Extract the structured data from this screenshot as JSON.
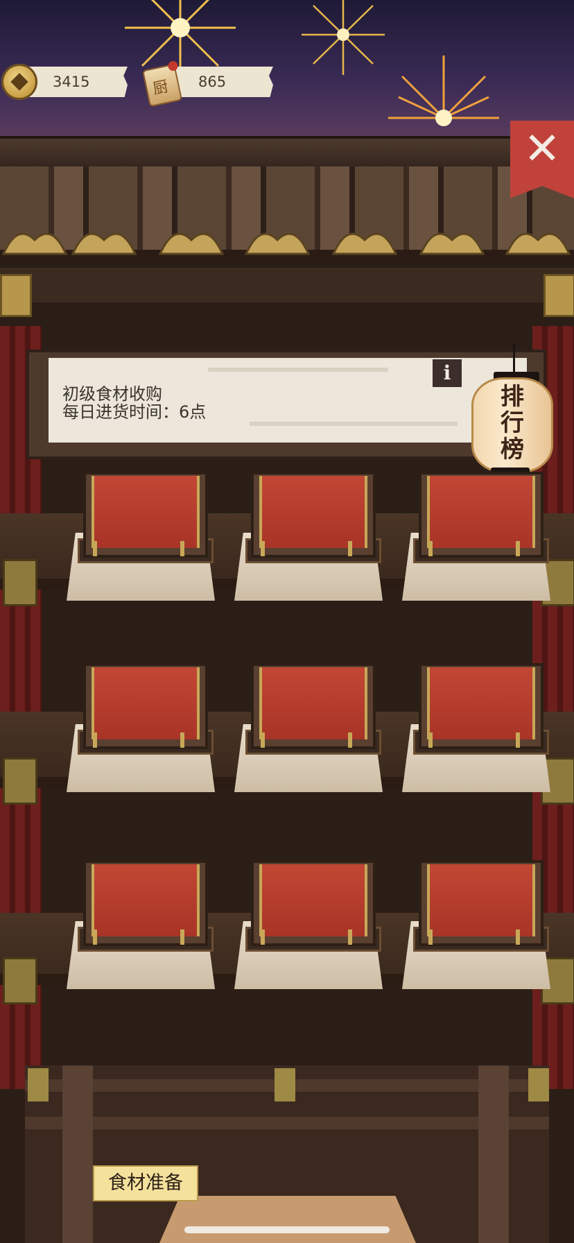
{
  "currency": {
    "coins": "3415",
    "tickets": "865"
  },
  "banner": {
    "title": "初级食材收购",
    "subtitle": "每日进货时间：6点",
    "info_label": "i"
  },
  "leaderboard_label": "排\n行\n榜",
  "close_label": "✕",
  "prep_label": "食材准备",
  "shelves": [
    {
      "slots": 3
    },
    {
      "slots": 3
    },
    {
      "slots": 3
    }
  ],
  "colors": {
    "close_button": "#c1423a",
    "box_cover": "#b13a2c",
    "cloth": "#e2d6c2",
    "lantern": "#f6dfbb",
    "prep_tag": "#f4e19c"
  },
  "icons": [
    "coin-icon",
    "ticket-icon",
    "close-icon",
    "info-icon",
    "lantern-icon"
  ]
}
